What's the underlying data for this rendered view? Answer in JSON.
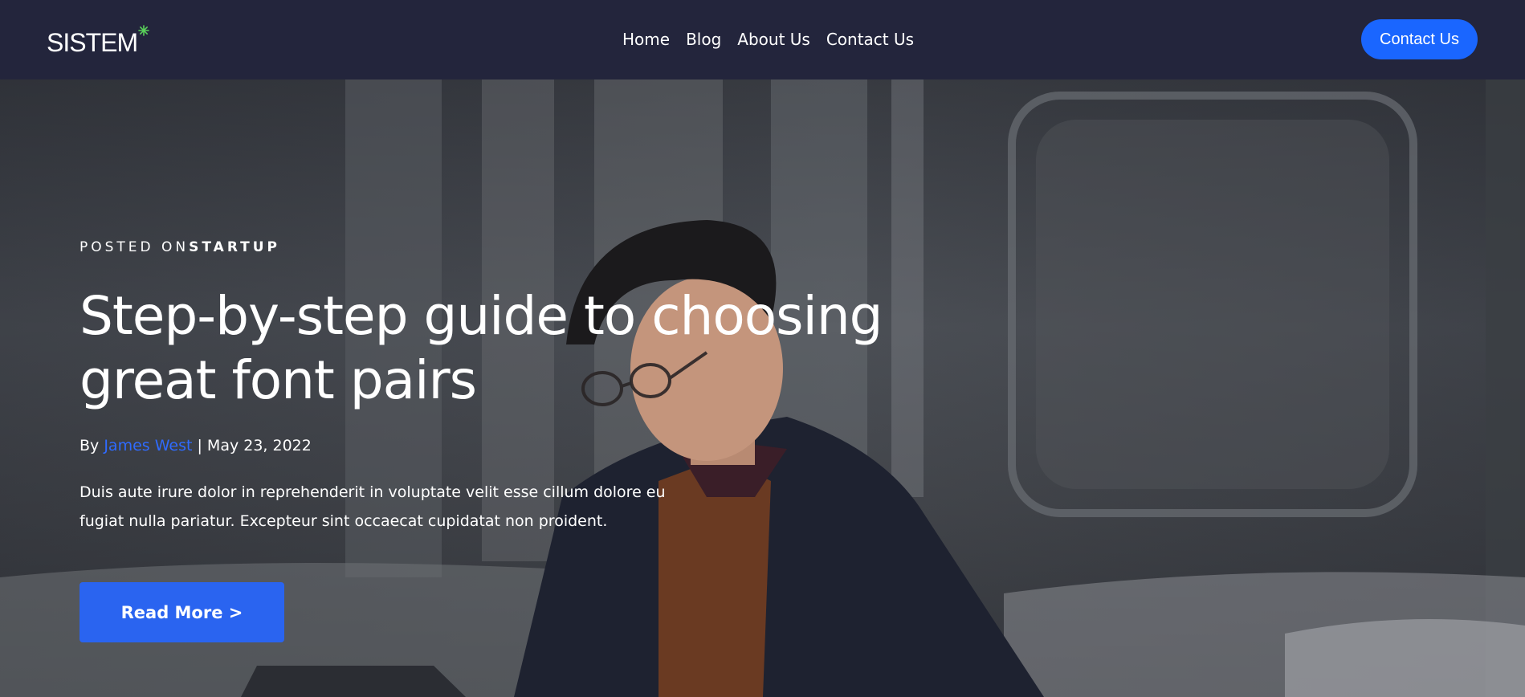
{
  "header": {
    "logo_text": "SISTEM",
    "nav": [
      {
        "label": "Home"
      },
      {
        "label": "Blog"
      },
      {
        "label": "About Us"
      },
      {
        "label": "Contact Us"
      }
    ],
    "cta_label": "Contact Us"
  },
  "hero": {
    "eyebrow_prefix": "POSTED ON",
    "category": "STARTUP",
    "title": "Step-by-step guide to choosing great font pairs",
    "by_prefix": "By ",
    "author": "James West",
    "date_sep": " | ",
    "date": "May 23, 2022",
    "excerpt": "Duis aute irure dolor in reprehenderit in voluptate velit esse cillum dolore eu fugiat nulla pariatur. Excepteur sint occaecat cupidatat non proident.",
    "read_more_label": "Read More >"
  },
  "colors": {
    "header_bg": "#23253c",
    "accent": "#1a66ff",
    "button": "#2a64f0",
    "author_link": "#2f6bff",
    "logo_star": "#5ad15a"
  },
  "icons": {
    "logo_star": "sparkle-star-icon"
  }
}
